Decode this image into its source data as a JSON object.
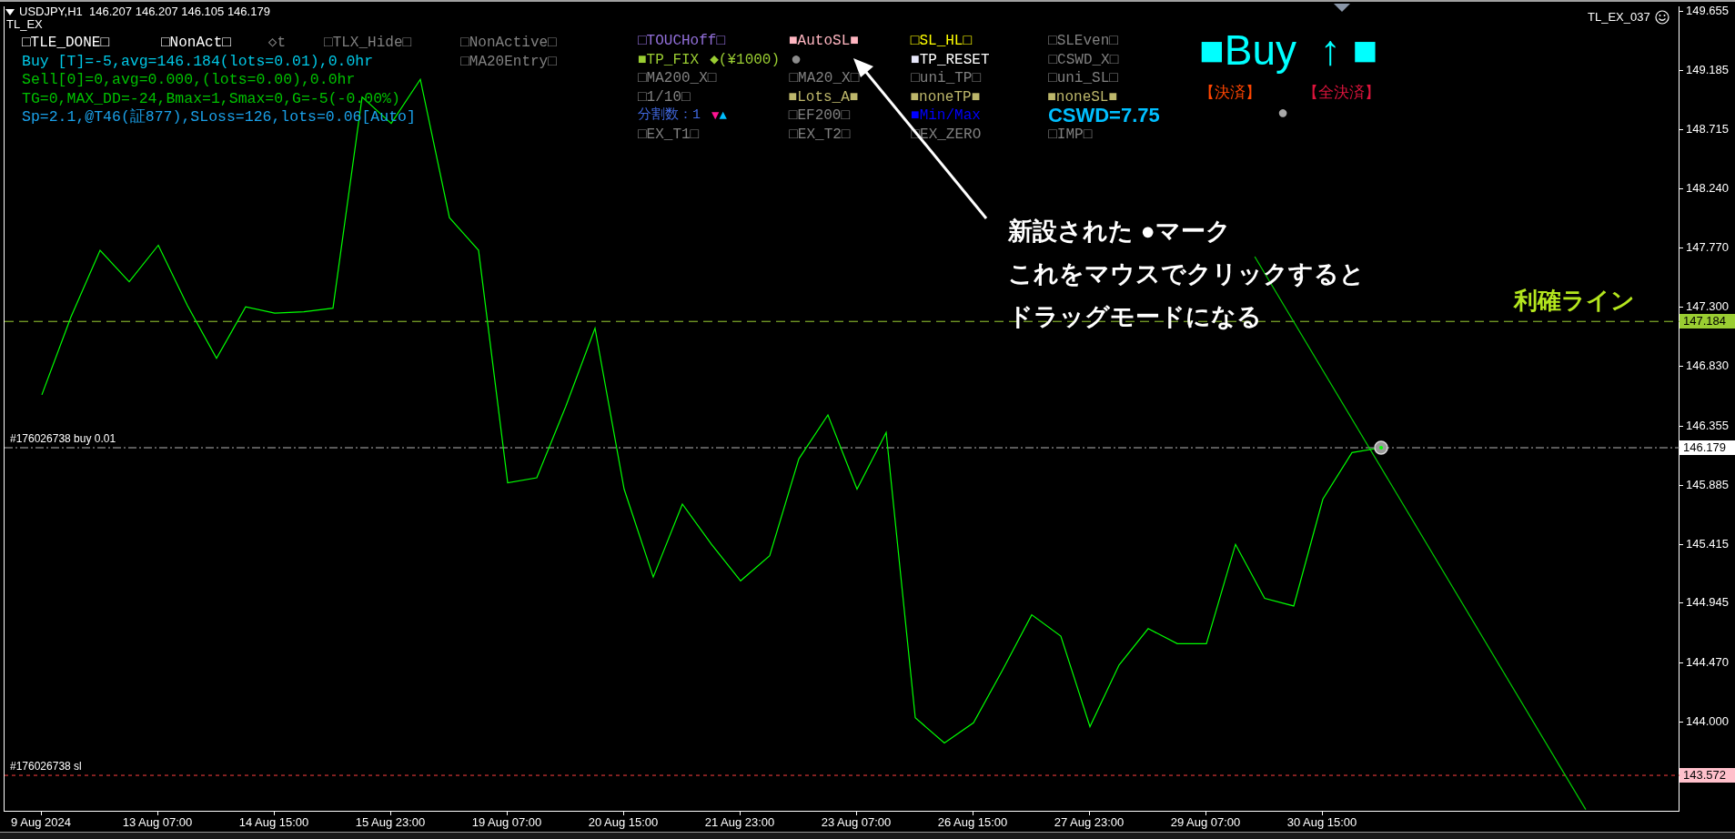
{
  "header": {
    "title": "USDJPY,H1  146.207 146.207 146.105 146.179",
    "indicator": "TL_EX",
    "expert": "TL_EX_037"
  },
  "left_panel": {
    "lines": [
      {
        "labels": [
          {
            "items": [
              {
                "kind": "toggle",
                "parts": [
                  {
                    "text": "□TLE_DONE□",
                    "color": "#ffffff"
                  }
                ]
              }
            ]
          },
          {
            "items": [
              {
                "kind": "toggle",
                "parts": [
                  {
                    "text": "□NonAct□",
                    "color": "#ffffff"
                  }
                ]
              }
            ]
          },
          {
            "items": [
              {
                "kind": "toggle",
                "parts": [
                  {
                    "text": "◇t",
                    "color": "#808080"
                  }
                ]
              }
            ]
          },
          {
            "items": [
              {
                "kind": "toggle",
                "parts": [
                  {
                    "text": "□TLX_Hide□",
                    "color": "#808080"
                  }
                ]
              }
            ]
          },
          {
            "items": [
              {
                "kind": "toggle",
                "parts": [
                  {
                    "text": "□NonActive□",
                    "color": "#808080"
                  }
                ]
              }
            ]
          }
        ]
      },
      {
        "labels": [
          {
            "items": [
              {
                "kind": "status",
                "parts": [
                  {
                    "text": "Buy [T]=-5,avg=146.184(lots=0.01),0.0hr",
                    "color": "#00c8e6"
                  }
                ]
              }
            ]
          },
          {
            "items": [
              {
                "kind": "toggle",
                "parts": [
                  {
                    "text": "□MA20Entry□",
                    "color": "#808080"
                  }
                ]
              }
            ]
          }
        ]
      },
      {
        "labels": [
          {
            "items": [
              {
                "kind": "status",
                "parts": [
                  {
                    "text": "Sell[0]=0,avg=0.000,(lots=0.00),0.0hr",
                    "color": "#00c000"
                  }
                ]
              }
            ]
          }
        ]
      },
      {
        "labels": [
          {
            "items": [
              {
                "kind": "status",
                "parts": [
                  {
                    "text": "TG=0,MAX_DD=-24,Bmax=1,Smax=0,G=-5(-0.00%)",
                    "color": "#00c000"
                  }
                ]
              }
            ]
          }
        ]
      },
      {
        "labels": [
          {
            "items": [
              {
                "kind": "status",
                "parts": [
                  {
                    "text": "Sp=2.1,@T46(証877),SLoss=126,lots=0.06[Auto]",
                    "color": "#1aa0e8"
                  }
                ]
              }
            ]
          }
        ]
      }
    ]
  },
  "middle_panel": {
    "lines": [
      {
        "labels": [
          {
            "items": [
              {
                "kind": "toggle",
                "parts": [
                  {
                    "text": "□TOUCHoff□",
                    "color": "#9370db"
                  }
                ]
              }
            ]
          },
          {
            "items": [
              {
                "kind": "toggle",
                "parts": [
                  {
                    "text": "■AutoSL■",
                    "color": "#ffb6c1"
                  }
                ]
              }
            ]
          },
          {
            "items": [
              {
                "kind": "toggle",
                "parts": [
                  {
                    "text": "□SL_HL□",
                    "color": "#ffff00"
                  }
                ]
              }
            ]
          },
          {
            "items": [
              {
                "kind": "toggle",
                "parts": [
                  {
                    "text": "□SLEven□",
                    "color": "#808080"
                  }
                ]
              }
            ]
          }
        ]
      },
      {
        "labels": [
          {
            "items": [
              {
                "kind": "toggle",
                "parts": [
                  {
                    "text": "■TP_FIX",
                    "color": "#9acd32"
                  }
                ]
              },
              {
                "kind": "value",
                "parts": [
                  {
                    "text": "◆(¥1000)",
                    "color": "#9acd32"
                  }
                ]
              },
              {
                "kind": "handle",
                "parts": [
                  {
                    "text": "●",
                    "color": "#8c8c8c"
                  }
                ]
              }
            ]
          },
          {
            "items": [
              {
                "kind": "toggle",
                "parts": [
                  {
                    "text": "■",
                    "color": "#e6e6fa"
                  },
                  {
                    "text": "TP_RESET",
                    "color": "#ffffff"
                  }
                ]
              }
            ]
          },
          {
            "items": [
              {
                "kind": "toggle",
                "parts": [
                  {
                    "text": "□CSWD_X□",
                    "color": "#808080"
                  }
                ]
              }
            ]
          }
        ]
      },
      {
        "labels": [
          {
            "items": [
              {
                "kind": "toggle",
                "parts": [
                  {
                    "text": "□MA200_X□",
                    "color": "#808080"
                  }
                ]
              }
            ]
          },
          {
            "items": [
              {
                "kind": "toggle",
                "parts": [
                  {
                    "text": "□MA20_X□",
                    "color": "#808080"
                  }
                ]
              }
            ]
          },
          {
            "items": [
              {
                "kind": "toggle",
                "parts": [
                  {
                    "text": "□uni_TP□",
                    "color": "#808080"
                  }
                ]
              }
            ]
          },
          {
            "items": [
              {
                "kind": "toggle",
                "parts": [
                  {
                    "text": "□uni_SL□",
                    "color": "#808080"
                  }
                ]
              }
            ]
          }
        ]
      },
      {
        "labels": [
          {
            "items": [
              {
                "kind": "toggle",
                "parts": [
                  {
                    "text": "□1/10□",
                    "color": "#808080"
                  }
                ]
              }
            ]
          },
          {
            "items": [
              {
                "kind": "toggle",
                "parts": [
                  {
                    "text": "■Lots_A■",
                    "color": "#bdb76b"
                  }
                ]
              }
            ]
          },
          {
            "items": [
              {
                "kind": "toggle",
                "parts": [
                  {
                    "text": "■noneTP■",
                    "color": "#bdb76b"
                  }
                ]
              }
            ]
          },
          {
            "items": [
              {
                "kind": "toggle",
                "parts": [
                  {
                    "text": "■noneSL■",
                    "color": "#bdb76b"
                  }
                ]
              }
            ]
          }
        ]
      },
      {
        "labels": [
          {
            "items": [
              {
                "kind": "count",
                "parts": [
                  {
                    "text": "分割数：1",
                    "color": "#4169e1"
                  }
                ]
              },
              {
                "kind": "stepper",
                "parts": [
                  {
                    "text": "▼",
                    "color": "#ff1493"
                  },
                  {
                    "text": "▲",
                    "color": "#00bfff"
                  }
                ]
              }
            ]
          },
          {
            "items": [
              {
                "kind": "toggle",
                "parts": [
                  {
                    "text": "□EF200□",
                    "color": "#808080"
                  }
                ]
              }
            ]
          },
          {
            "items": [
              {
                "kind": "toggle",
                "parts": [
                  {
                    "text": "■",
                    "color": "#0000ff"
                  },
                  {
                    "text": "Min/Max",
                    "color": "#0000ff"
                  }
                ]
              }
            ]
          },
          {
            "items": [
              {
                "kind": "reading",
                "parts": [
                  {
                    "text": "CSWD=7.75",
                    "color": "#00bfff"
                  }
                ]
              }
            ]
          }
        ]
      },
      {
        "labels": [
          {
            "items": [
              {
                "kind": "toggle",
                "parts": [
                  {
                    "text": "□EX_T1□",
                    "color": "#808080"
                  }
                ]
              }
            ]
          },
          {
            "items": [
              {
                "kind": "toggle",
                "parts": [
                  {
                    "text": "□EX_T2□",
                    "color": "#808080"
                  }
                ]
              }
            ]
          },
          {
            "items": [
              {
                "kind": "toggle",
                "parts": [
                  {
                    "text": "□EX_ZERO",
                    "color": "#808080"
                  }
                ]
              }
            ]
          },
          {
            "items": [
              {
                "kind": "toggle",
                "parts": [
                  {
                    "text": "□IMP□",
                    "color": "#808080"
                  }
                ]
              }
            ]
          }
        ]
      }
    ]
  },
  "right_panel": {
    "signal": {
      "text": "■Buy  ↑ ■",
      "color": "#00ffff"
    },
    "buttons": [
      {
        "text": "【決済】",
        "color": "#ff4500"
      },
      {
        "text": "【全決済】",
        "color": "#dc143c"
      }
    ],
    "handle": {
      "text": "●",
      "color": "#a8a8a8"
    }
  },
  "callout": {
    "lines": [
      "新設された ●マーク",
      "これをマウスでクリックすると",
      "ドラッグモードになる"
    ]
  },
  "tp_line_label": {
    "text": "利確ライン",
    "color": "#b4e61e"
  },
  "chart_data": {
    "type": "line",
    "categories": [
      "9 Aug 2024",
      null,
      null,
      null,
      "13 Aug 07:00",
      null,
      null,
      null,
      "14 Aug 15:00",
      null,
      null,
      null,
      "15 Aug 23:00",
      null,
      null,
      null,
      "19 Aug 07:00",
      null,
      null,
      null,
      "20 Aug 15:00",
      null,
      null,
      null,
      "21 Aug 23:00",
      null,
      null,
      null,
      "23 Aug 07:00",
      null,
      null,
      null,
      "26 Aug 15:00",
      null,
      null,
      null,
      "27 Aug 23:00",
      null,
      null,
      null,
      "29 Aug 07:00",
      null,
      null,
      null,
      "30 Aug 15:00",
      null,
      null,
      null,
      null,
      null,
      null,
      null,
      null,
      null,
      null,
      null,
      null,
      null
    ],
    "series": [
      {
        "color": "#00ff00",
        "values": [
          146.6,
          147.22,
          147.75,
          147.5,
          147.79,
          147.31,
          146.89,
          147.3,
          147.25,
          147.26,
          147.29,
          148.97,
          148.76,
          149.11,
          148.01,
          147.75,
          145.9,
          145.94,
          146.51,
          147.13,
          145.85,
          145.15,
          145.73,
          145.41,
          145.12,
          145.32,
          146.09,
          146.44,
          145.85,
          146.3,
          144.03,
          143.83,
          143.99,
          144.41,
          144.85,
          144.68,
          143.96,
          144.45,
          144.74,
          144.62,
          144.62,
          145.41,
          144.98,
          144.92,
          145.77,
          146.14,
          146.179,
          null,
          null,
          null,
          null,
          null,
          null,
          null,
          null,
          null,
          null,
          null
        ]
      }
    ],
    "ylim": [
      143.29,
      149.691
    ],
    "yticks": [
      {
        "value": 149.655,
        "label": "149.655"
      },
      {
        "value": 149.185,
        "label": "149.185"
      },
      {
        "value": 148.715,
        "label": "148.715"
      },
      {
        "value": 148.24,
        "label": "148.240"
      },
      {
        "value": 147.77,
        "label": "147.770"
      },
      {
        "value": 147.3,
        "label": "147.300"
      },
      {
        "value": 146.83,
        "label": "146.830"
      },
      {
        "value": 146.355,
        "label": "146.355"
      },
      {
        "value": 145.885,
        "label": "145.885"
      },
      {
        "value": 145.415,
        "label": "145.415"
      },
      {
        "value": 144.945,
        "label": "144.945"
      },
      {
        "value": 144.47,
        "label": "144.470"
      },
      {
        "value": 144.0,
        "label": "144.000"
      }
    ],
    "ref_lines": [
      {
        "axis": "y",
        "value": 147.184,
        "label": "147.184",
        "color": "#9acd32"
      },
      {
        "axis": "y",
        "value": 146.179,
        "label": "146.179",
        "color": "#b4b4b4"
      },
      {
        "axis": "y",
        "value": 143.572,
        "label": "143.572",
        "color": "#ff4040"
      }
    ],
    "annotations": [
      "#176026738 buy 0.01",
      "#176026738 sl"
    ]
  }
}
